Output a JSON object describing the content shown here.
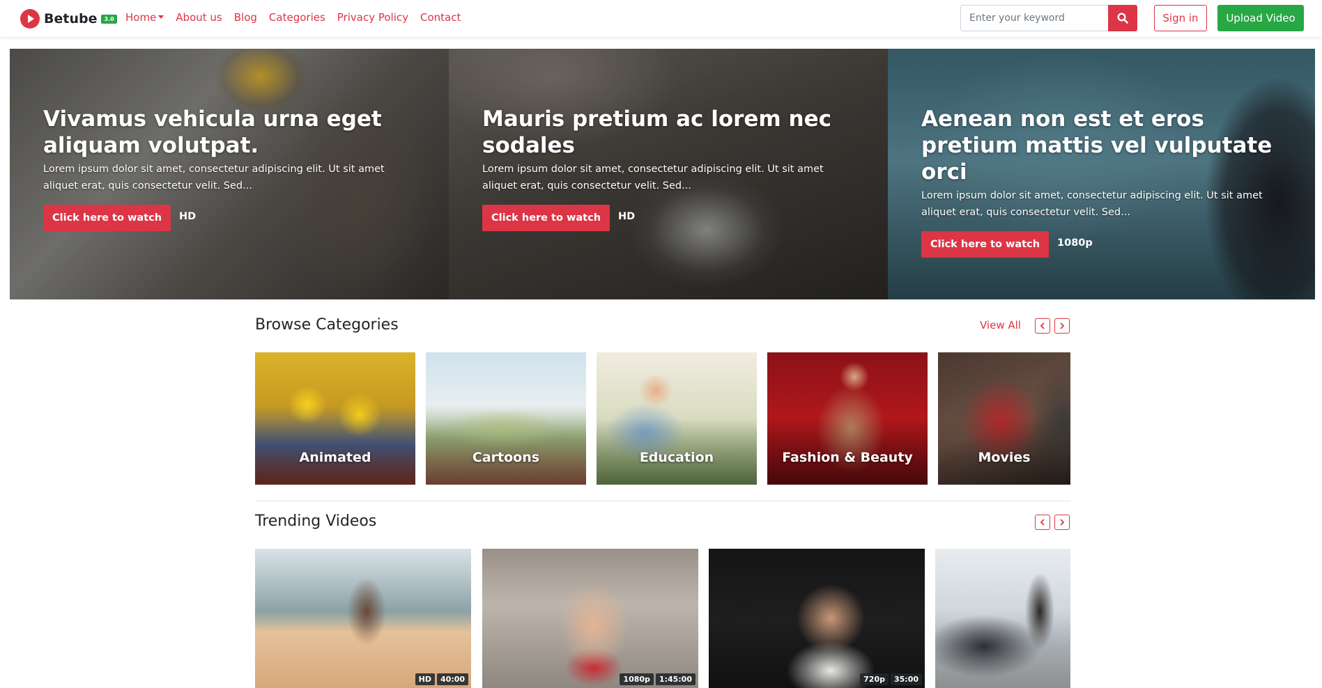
{
  "brand": {
    "name": "Betube",
    "badge": "3.0"
  },
  "nav": {
    "items": [
      {
        "label": "Home",
        "dropdown": true
      },
      {
        "label": "About us"
      },
      {
        "label": "Blog"
      },
      {
        "label": "Categories"
      },
      {
        "label": "Privacy Policy"
      },
      {
        "label": "Contact"
      }
    ]
  },
  "search": {
    "placeholder": "Enter your keyword",
    "icon": "search-icon"
  },
  "auth": {
    "signin": "Sign in",
    "upload": "Upload Video"
  },
  "hero": {
    "slides": [
      {
        "title": "Vivamus vehicula urna eget aliquam volutpat.",
        "desc": "Lorem ipsum dolor sit amet, consectetur adipiscing elit. Ut sit amet aliquet erat, quis consectetur velit. Sed...",
        "button": "Click here to watch",
        "quality": "HD"
      },
      {
        "title": "Mauris pretium ac lorem nec sodales",
        "desc": "Lorem ipsum dolor sit amet, consectetur adipiscing elit. Ut sit amet aliquet erat, quis consectetur velit. Sed...",
        "button": "Click here to watch",
        "quality": "HD"
      },
      {
        "title": "Aenean non est et eros pretium mattis vel vulputate orci",
        "desc": "Lorem ipsum dolor sit amet, consectetur adipiscing elit. Ut sit amet aliquet erat, quis consectetur velit. Sed...",
        "button": "Click here to watch",
        "quality": "1080p"
      }
    ]
  },
  "categories": {
    "title": "Browse Categories",
    "view_all": "View All",
    "items": [
      {
        "label": "Animated"
      },
      {
        "label": "Cartoons"
      },
      {
        "label": "Education"
      },
      {
        "label": "Fashion & Beauty"
      },
      {
        "label": "Movies"
      }
    ]
  },
  "trending": {
    "title": "Trending Videos",
    "videos": [
      {
        "quality": "HD",
        "duration": "40:00"
      },
      {
        "quality": "1080p",
        "duration": "1:45:00"
      },
      {
        "quality": "720p",
        "duration": "35:00"
      },
      {
        "quality": "",
        "duration": ""
      }
    ]
  },
  "colors": {
    "accent": "#dc3545",
    "success": "#28a745",
    "text": "#212529"
  }
}
